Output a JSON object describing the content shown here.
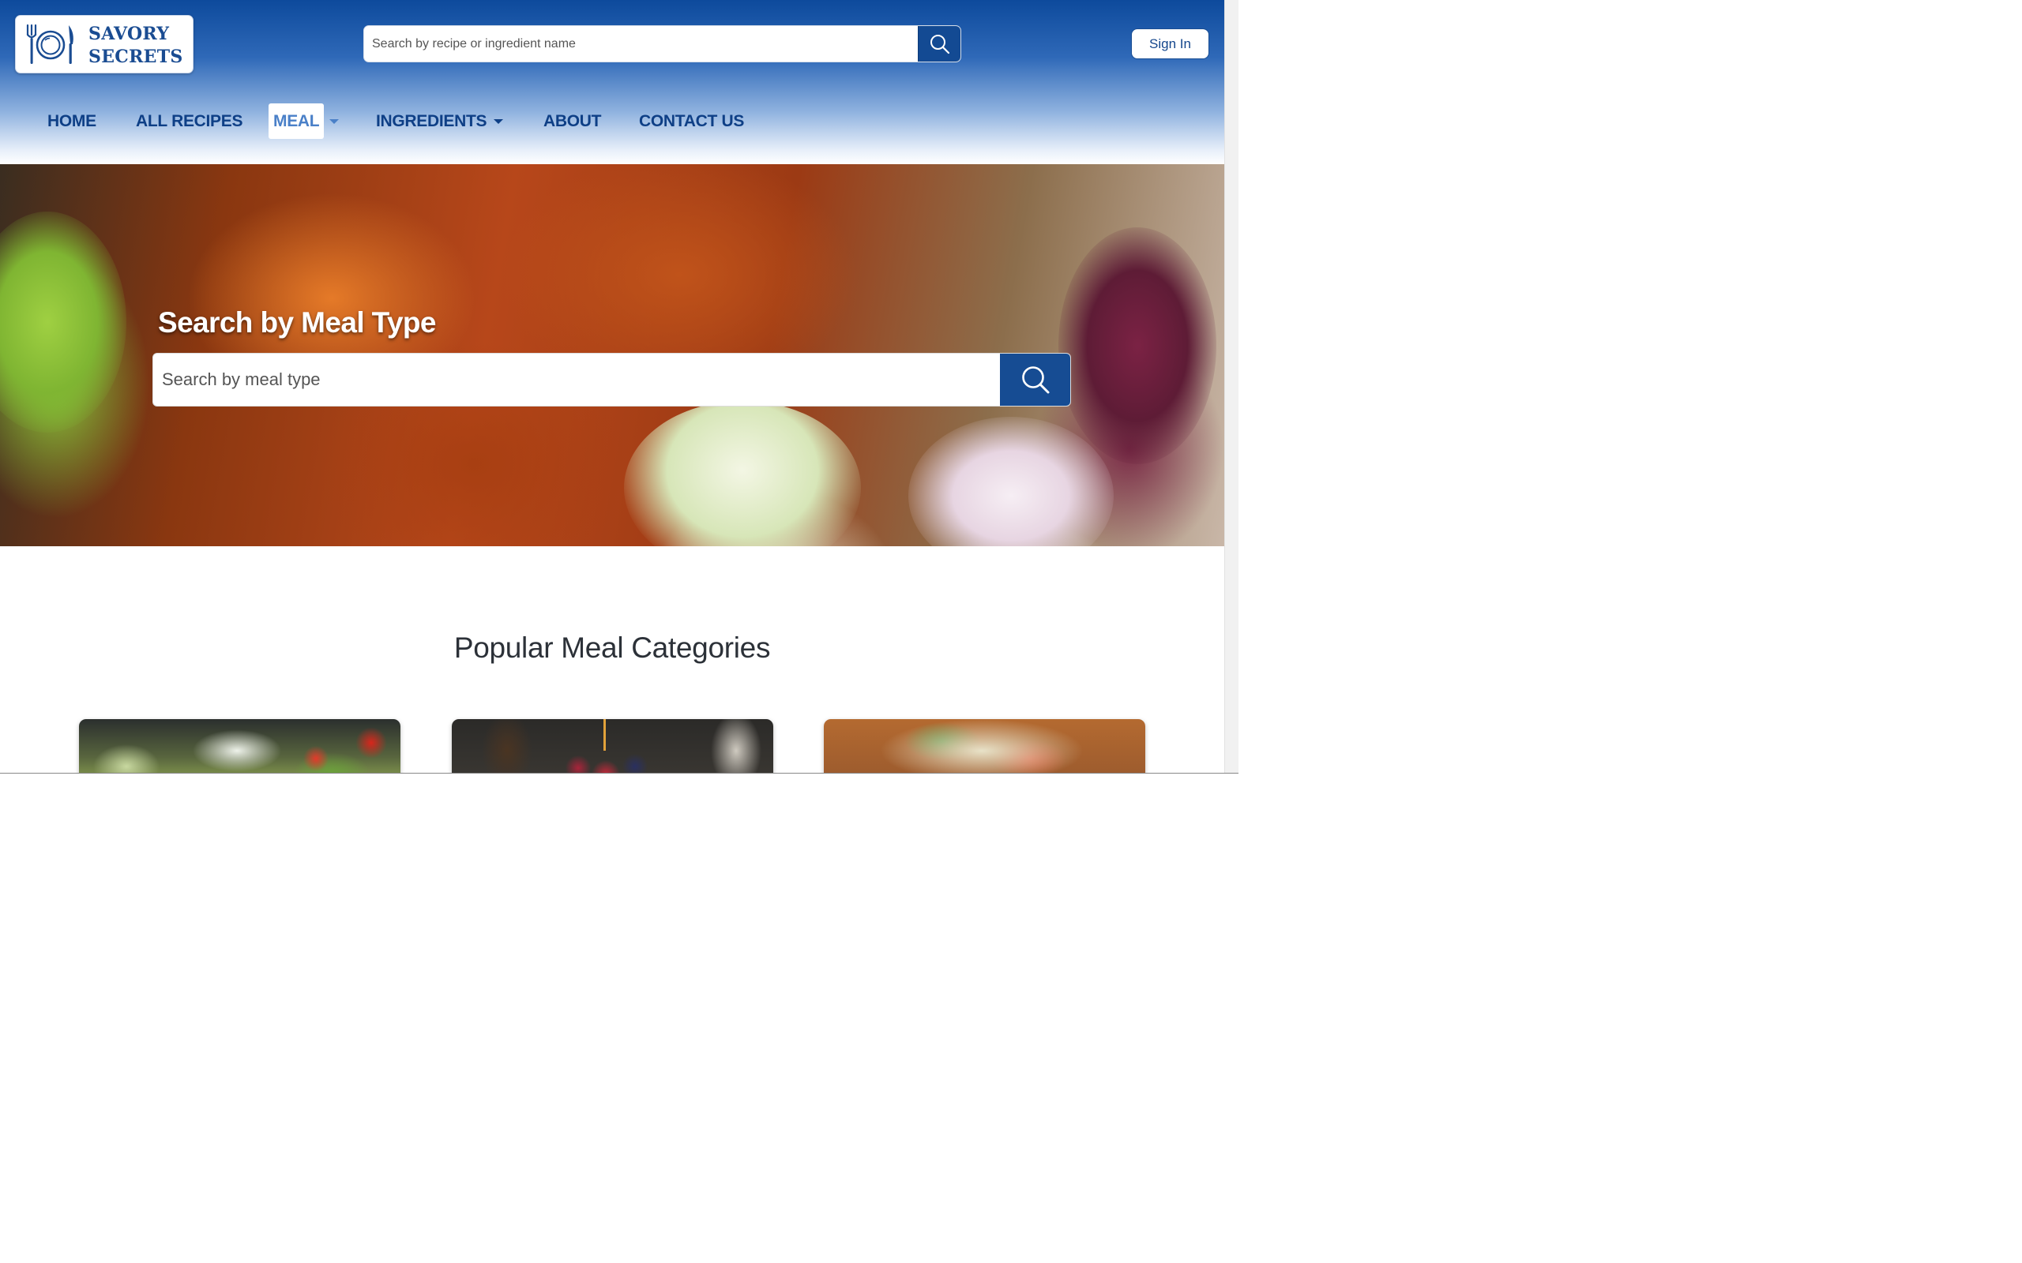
{
  "brand": {
    "line1": "SAVORY",
    "line2": "SECRETS",
    "color": "#1a4c92"
  },
  "header": {
    "search_placeholder": "Search by recipe or ingredient name",
    "signin_label": "Sign In"
  },
  "nav": {
    "items": [
      {
        "label": "HOME"
      },
      {
        "label": "ALL RECIPES"
      },
      {
        "label": "MEAL"
      },
      {
        "label": "INGREDIENTS"
      },
      {
        "label": "ABOUT"
      },
      {
        "label": "CONTACT US"
      }
    ],
    "active": "MEAL"
  },
  "hero": {
    "title": "Search by Meal Type",
    "search_placeholder": "Search by meal type"
  },
  "popular": {
    "title": "Popular Meal Categories"
  },
  "colors": {
    "primary": "#134a93",
    "nav_text": "#0e3f86",
    "active_nav": "#4a80c8"
  },
  "icons": [
    "fork-plate-knife-icon",
    "search-icon",
    "chevron-down-icon"
  ]
}
